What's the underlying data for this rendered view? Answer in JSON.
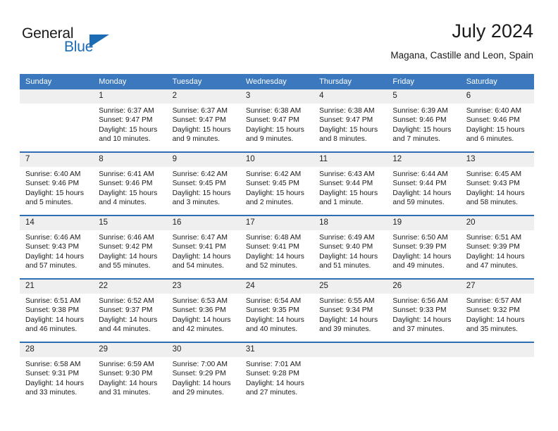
{
  "brand": {
    "name_part1": "General",
    "name_part2": "Blue",
    "accent_color": "#1b6cb5"
  },
  "header": {
    "title": "July 2024",
    "subtitle": "Magana, Castille and Leon, Spain"
  },
  "theme": {
    "header_row_bg": "#3b78bd",
    "week_separator": "#2f6eb5",
    "daynum_bg": "#efefef"
  },
  "weekday_headers": [
    "Sunday",
    "Monday",
    "Tuesday",
    "Wednesday",
    "Thursday",
    "Friday",
    "Saturday"
  ],
  "weeks": [
    [
      {
        "day": "",
        "sunrise": "",
        "sunset": "",
        "daylight": "",
        "empty": true
      },
      {
        "day": "1",
        "sunrise": "Sunrise: 6:37 AM",
        "sunset": "Sunset: 9:47 PM",
        "daylight": "Daylight: 15 hours and 10 minutes."
      },
      {
        "day": "2",
        "sunrise": "Sunrise: 6:37 AM",
        "sunset": "Sunset: 9:47 PM",
        "daylight": "Daylight: 15 hours and 9 minutes."
      },
      {
        "day": "3",
        "sunrise": "Sunrise: 6:38 AM",
        "sunset": "Sunset: 9:47 PM",
        "daylight": "Daylight: 15 hours and 9 minutes."
      },
      {
        "day": "4",
        "sunrise": "Sunrise: 6:38 AM",
        "sunset": "Sunset: 9:47 PM",
        "daylight": "Daylight: 15 hours and 8 minutes."
      },
      {
        "day": "5",
        "sunrise": "Sunrise: 6:39 AM",
        "sunset": "Sunset: 9:46 PM",
        "daylight": "Daylight: 15 hours and 7 minutes."
      },
      {
        "day": "6",
        "sunrise": "Sunrise: 6:40 AM",
        "sunset": "Sunset: 9:46 PM",
        "daylight": "Daylight: 15 hours and 6 minutes."
      }
    ],
    [
      {
        "day": "7",
        "sunrise": "Sunrise: 6:40 AM",
        "sunset": "Sunset: 9:46 PM",
        "daylight": "Daylight: 15 hours and 5 minutes."
      },
      {
        "day": "8",
        "sunrise": "Sunrise: 6:41 AM",
        "sunset": "Sunset: 9:46 PM",
        "daylight": "Daylight: 15 hours and 4 minutes."
      },
      {
        "day": "9",
        "sunrise": "Sunrise: 6:42 AM",
        "sunset": "Sunset: 9:45 PM",
        "daylight": "Daylight: 15 hours and 3 minutes."
      },
      {
        "day": "10",
        "sunrise": "Sunrise: 6:42 AM",
        "sunset": "Sunset: 9:45 PM",
        "daylight": "Daylight: 15 hours and 2 minutes."
      },
      {
        "day": "11",
        "sunrise": "Sunrise: 6:43 AM",
        "sunset": "Sunset: 9:44 PM",
        "daylight": "Daylight: 15 hours and 1 minute."
      },
      {
        "day": "12",
        "sunrise": "Sunrise: 6:44 AM",
        "sunset": "Sunset: 9:44 PM",
        "daylight": "Daylight: 14 hours and 59 minutes."
      },
      {
        "day": "13",
        "sunrise": "Sunrise: 6:45 AM",
        "sunset": "Sunset: 9:43 PM",
        "daylight": "Daylight: 14 hours and 58 minutes."
      }
    ],
    [
      {
        "day": "14",
        "sunrise": "Sunrise: 6:46 AM",
        "sunset": "Sunset: 9:43 PM",
        "daylight": "Daylight: 14 hours and 57 minutes."
      },
      {
        "day": "15",
        "sunrise": "Sunrise: 6:46 AM",
        "sunset": "Sunset: 9:42 PM",
        "daylight": "Daylight: 14 hours and 55 minutes."
      },
      {
        "day": "16",
        "sunrise": "Sunrise: 6:47 AM",
        "sunset": "Sunset: 9:41 PM",
        "daylight": "Daylight: 14 hours and 54 minutes."
      },
      {
        "day": "17",
        "sunrise": "Sunrise: 6:48 AM",
        "sunset": "Sunset: 9:41 PM",
        "daylight": "Daylight: 14 hours and 52 minutes."
      },
      {
        "day": "18",
        "sunrise": "Sunrise: 6:49 AM",
        "sunset": "Sunset: 9:40 PM",
        "daylight": "Daylight: 14 hours and 51 minutes."
      },
      {
        "day": "19",
        "sunrise": "Sunrise: 6:50 AM",
        "sunset": "Sunset: 9:39 PM",
        "daylight": "Daylight: 14 hours and 49 minutes."
      },
      {
        "day": "20",
        "sunrise": "Sunrise: 6:51 AM",
        "sunset": "Sunset: 9:39 PM",
        "daylight": "Daylight: 14 hours and 47 minutes."
      }
    ],
    [
      {
        "day": "21",
        "sunrise": "Sunrise: 6:51 AM",
        "sunset": "Sunset: 9:38 PM",
        "daylight": "Daylight: 14 hours and 46 minutes."
      },
      {
        "day": "22",
        "sunrise": "Sunrise: 6:52 AM",
        "sunset": "Sunset: 9:37 PM",
        "daylight": "Daylight: 14 hours and 44 minutes."
      },
      {
        "day": "23",
        "sunrise": "Sunrise: 6:53 AM",
        "sunset": "Sunset: 9:36 PM",
        "daylight": "Daylight: 14 hours and 42 minutes."
      },
      {
        "day": "24",
        "sunrise": "Sunrise: 6:54 AM",
        "sunset": "Sunset: 9:35 PM",
        "daylight": "Daylight: 14 hours and 40 minutes."
      },
      {
        "day": "25",
        "sunrise": "Sunrise: 6:55 AM",
        "sunset": "Sunset: 9:34 PM",
        "daylight": "Daylight: 14 hours and 39 minutes."
      },
      {
        "day": "26",
        "sunrise": "Sunrise: 6:56 AM",
        "sunset": "Sunset: 9:33 PM",
        "daylight": "Daylight: 14 hours and 37 minutes."
      },
      {
        "day": "27",
        "sunrise": "Sunrise: 6:57 AM",
        "sunset": "Sunset: 9:32 PM",
        "daylight": "Daylight: 14 hours and 35 minutes."
      }
    ],
    [
      {
        "day": "28",
        "sunrise": "Sunrise: 6:58 AM",
        "sunset": "Sunset: 9:31 PM",
        "daylight": "Daylight: 14 hours and 33 minutes."
      },
      {
        "day": "29",
        "sunrise": "Sunrise: 6:59 AM",
        "sunset": "Sunset: 9:30 PM",
        "daylight": "Daylight: 14 hours and 31 minutes."
      },
      {
        "day": "30",
        "sunrise": "Sunrise: 7:00 AM",
        "sunset": "Sunset: 9:29 PM",
        "daylight": "Daylight: 14 hours and 29 minutes."
      },
      {
        "day": "31",
        "sunrise": "Sunrise: 7:01 AM",
        "sunset": "Sunset: 9:28 PM",
        "daylight": "Daylight: 14 hours and 27 minutes."
      },
      {
        "day": "",
        "sunrise": "",
        "sunset": "",
        "daylight": "",
        "empty": true
      },
      {
        "day": "",
        "sunrise": "",
        "sunset": "",
        "daylight": "",
        "empty": true
      },
      {
        "day": "",
        "sunrise": "",
        "sunset": "",
        "daylight": "",
        "empty": true
      }
    ]
  ]
}
